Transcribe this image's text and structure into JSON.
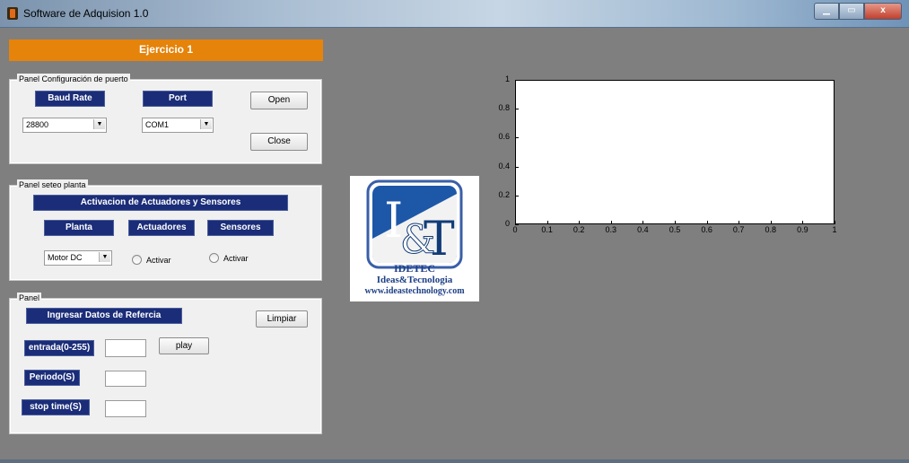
{
  "window": {
    "title": "Software de Adquision  1.0",
    "min_label": "▁",
    "max_label": "▭",
    "close_label": "x"
  },
  "header": {
    "title": "Ejercicio 1"
  },
  "panel_port": {
    "title": "Panel Configuración de puerto",
    "baud_rate_label": "Baud Rate",
    "port_label": "Port",
    "baud_rate_value": "28800",
    "port_value": "COM1",
    "open_label": "Open",
    "close_label": "Close"
  },
  "panel_plant": {
    "title": "Panel seteo planta",
    "activation_label": "Activacion de Actuadores y Sensores",
    "plant_label": "Planta",
    "actuators_label": "Actuadores",
    "sensors_label": "Sensores",
    "plant_value": "Motor DC",
    "actuator_radio_label": "Activar",
    "sensor_radio_label": "Activar"
  },
  "panel_data": {
    "title": "Panel",
    "reference_label": "Ingresar Datos de Refercia",
    "clear_label": "Limpiar",
    "input_label": "entrada(0-255)",
    "play_label": "play",
    "period_label": "Periodo(S)",
    "stop_time_label": "stop time(S)",
    "input_value": "",
    "period_value": "",
    "stop_time_value": ""
  },
  "logo": {
    "brand": "IDETEC",
    "line1": "Ideas&Tecnologia",
    "line2": "www.ideastechnology.com",
    "letters": "I&T"
  },
  "chart_data": {
    "type": "line",
    "series": [],
    "xlim": [
      0,
      1
    ],
    "ylim": [
      0,
      1
    ],
    "x_ticks": [
      "0",
      "0.1",
      "0.2",
      "0.3",
      "0.4",
      "0.5",
      "0.6",
      "0.7",
      "0.8",
      "0.9",
      "1"
    ],
    "y_ticks": [
      "0",
      "0.2",
      "0.4",
      "0.6",
      "0.8",
      "1"
    ],
    "grid": false
  },
  "colors": {
    "background": "#7f7f7f",
    "accent": "#e5830a",
    "label_bg": "#1b2d78"
  },
  "icons": {
    "dropdown": "chevron-down-icon",
    "app": "matlab-icon"
  }
}
